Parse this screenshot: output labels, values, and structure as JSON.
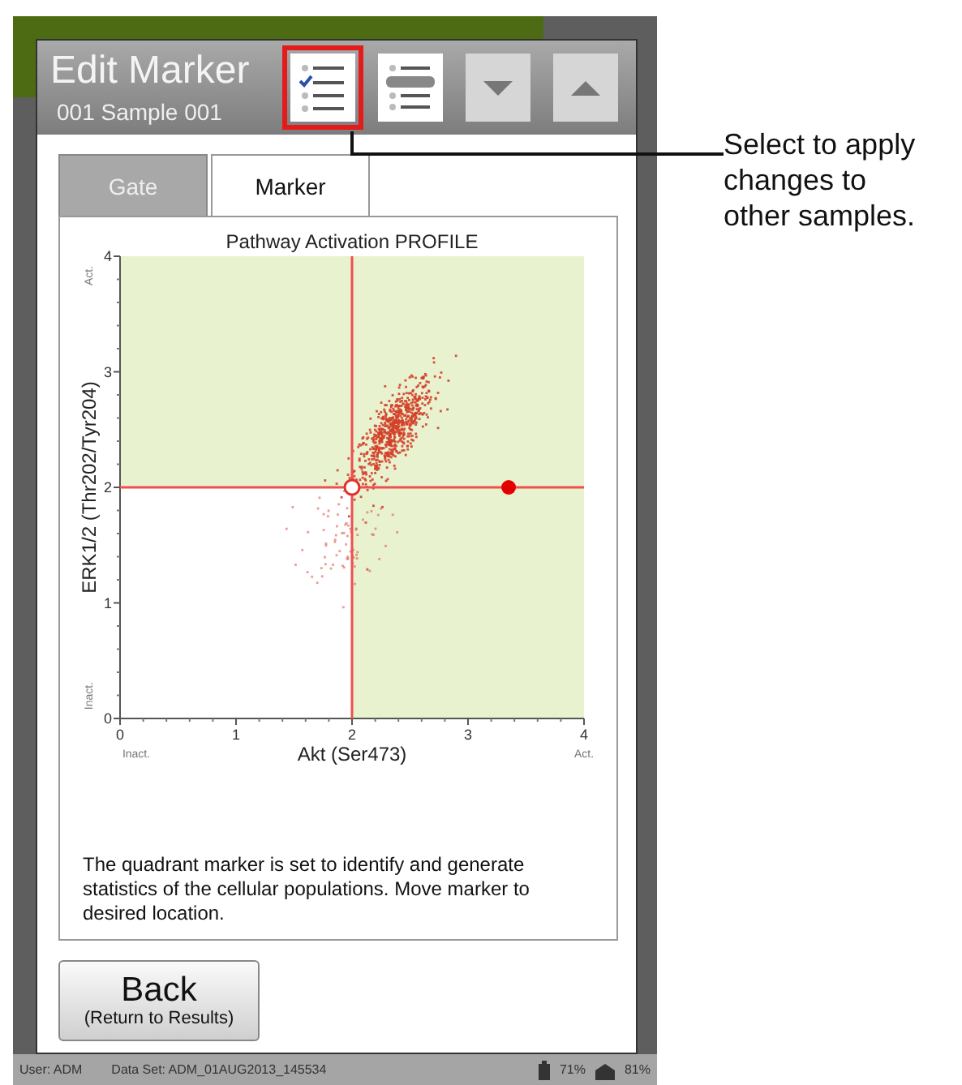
{
  "dialog": {
    "title": "Edit Marker",
    "subtitle": "001 Sample  001"
  },
  "toolbar": [
    {
      "kind": "apply",
      "highlighted": true
    },
    {
      "kind": "list",
      "highlighted": false
    },
    {
      "kind": "down",
      "highlighted": false
    },
    {
      "kind": "up",
      "highlighted": false
    }
  ],
  "tabs": [
    {
      "label": "Gate",
      "selected": false
    },
    {
      "label": "Marker",
      "selected": true
    }
  ],
  "chart": {
    "title": "Pathway Activation PROFILE",
    "y_label": "ERK1/2 (Thr202/Tyr204)",
    "x_label": "Akt (Ser473)",
    "x_ticks": [
      "0",
      "1",
      "2",
      "3",
      "4"
    ],
    "y_ticks": [
      "4",
      "3",
      "2",
      "1",
      "0"
    ],
    "x_low": "Inact.",
    "x_high": "Act.",
    "y_low": "Inact.",
    "y_high": "Act."
  },
  "description": "The quadrant marker is set to identify and generate statistics of the cellular populations. Move marker to desired location.",
  "back_button": {
    "label": "Back",
    "sublabel": "(Return to Results)"
  },
  "status_bar": {
    "user": "User: ADM",
    "data_set": "Data Set: ADM_01AUG2013_145534",
    "battery_1": "71%",
    "battery_2": "81%"
  },
  "callout": {
    "text": "Select to apply changes to other samples."
  }
}
